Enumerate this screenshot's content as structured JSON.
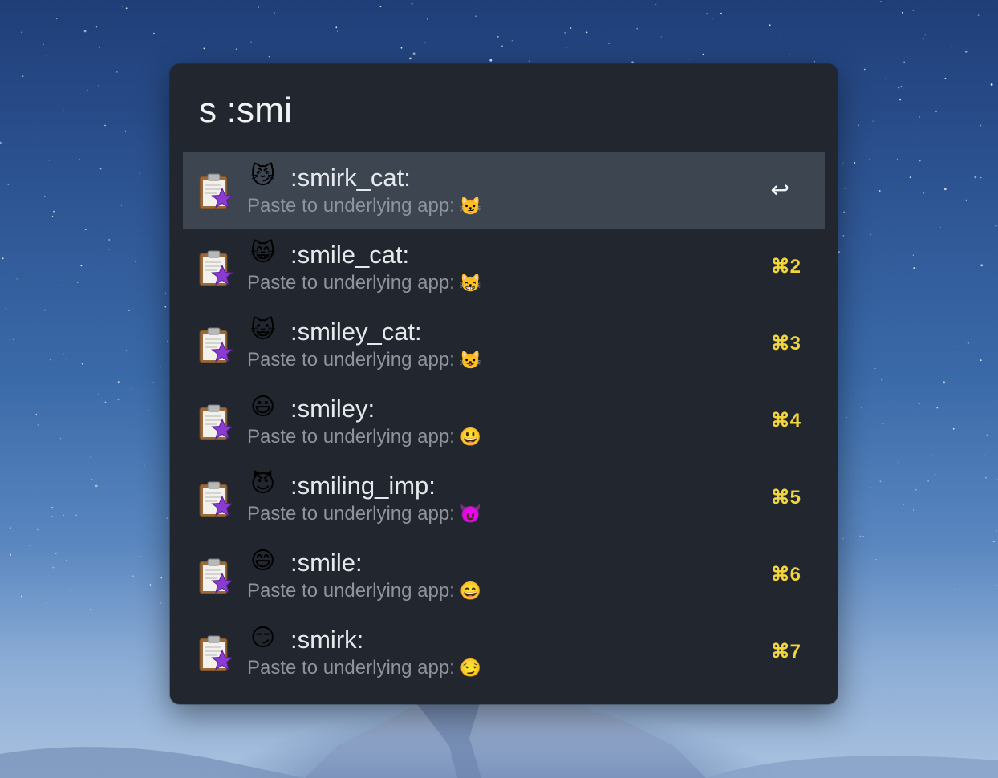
{
  "search": {
    "query": "s :smi"
  },
  "results": [
    {
      "emoji": "😼",
      "title": ":smirk_cat:",
      "subtitle": "Paste to underlying app:",
      "subtitle_emoji": "😼",
      "shortcut": "↩",
      "selected": true
    },
    {
      "emoji": "😸",
      "title": ":smile_cat:",
      "subtitle": "Paste to underlying app:",
      "subtitle_emoji": "😸",
      "shortcut": "⌘2",
      "selected": false
    },
    {
      "emoji": "😺",
      "title": ":smiley_cat:",
      "subtitle": "Paste to underlying app:",
      "subtitle_emoji": "😺",
      "shortcut": "⌘3",
      "selected": false
    },
    {
      "emoji": "😃",
      "title": ":smiley:",
      "subtitle": "Paste to underlying app:",
      "subtitle_emoji": "😃",
      "shortcut": "⌘4",
      "selected": false
    },
    {
      "emoji": "😈",
      "title": ":smiling_imp:",
      "subtitle": "Paste to underlying app:",
      "subtitle_emoji": "😈",
      "shortcut": "⌘5",
      "selected": false
    },
    {
      "emoji": "😄",
      "title": ":smile:",
      "subtitle": "Paste to underlying app:",
      "subtitle_emoji": "😄",
      "shortcut": "⌘6",
      "selected": false
    },
    {
      "emoji": "😏",
      "title": ":smirk:",
      "subtitle": "Paste to underlying app:",
      "subtitle_emoji": "😏",
      "shortcut": "⌘7",
      "selected": false
    }
  ],
  "icons": {
    "result_icon": "clipboard-star-icon"
  },
  "colors": {
    "panel_background": "#22272f",
    "selected_row": "#3c4550",
    "shortcut": "#f1d53a",
    "subtitle": "#8d949c"
  }
}
